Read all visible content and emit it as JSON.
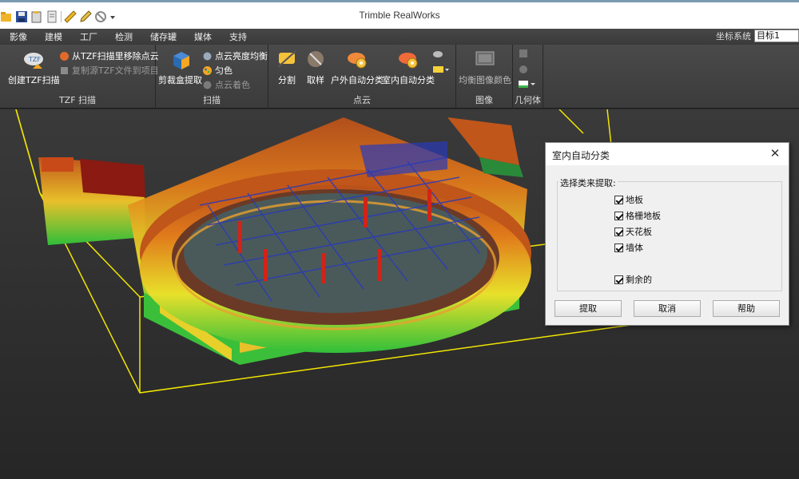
{
  "app": {
    "title": "Trimble RealWorks"
  },
  "quick_access": [
    "open-icon",
    "save-icon",
    "clipboard-icon",
    "doc-icon",
    "measure-icon",
    "edit-icon",
    "ban-icon",
    "dropdown-icon"
  ],
  "menu": [
    "影像",
    "建模",
    "工厂",
    "检测",
    "储存罐",
    "媒体",
    "支持"
  ],
  "coord": {
    "label": "坐标系统",
    "value": "目标1"
  },
  "ribbon": {
    "tzf": {
      "label": "TZF 扫描",
      "create": "创建TZF扫描",
      "remove": "从TZF扫描里移除点云",
      "copy": "复制源TZF文件到项目"
    },
    "scan": {
      "label": "扫描",
      "crop": "剪裁盒提取",
      "brightness": "点云亮度均衡",
      "uniform": "匀色",
      "colorize": "点云着色"
    },
    "cloud": {
      "label": "点云",
      "split": "分割",
      "sample": "取样",
      "outdoor": "户外自动分类",
      "indoor": "室内自动分类"
    },
    "image": {
      "label": "图像",
      "balance": "均衡图像颜色"
    },
    "geometry": {
      "label": "几何体"
    }
  },
  "dialog": {
    "title": "室内自动分类",
    "group_title": "选择类来提取:",
    "options": [
      {
        "label": "地板",
        "checked": true
      },
      {
        "label": "格栅地板",
        "checked": true
      },
      {
        "label": "天花板",
        "checked": true
      },
      {
        "label": "墙体",
        "checked": true
      },
      {
        "label": "剩余的",
        "checked": true
      }
    ],
    "buttons": {
      "extract": "提取",
      "cancel": "取消",
      "help": "帮助"
    }
  },
  "colors": {
    "bbox": "#f2e600",
    "ribbon_bg": "#444444",
    "accent_orange": "#f5a623"
  }
}
